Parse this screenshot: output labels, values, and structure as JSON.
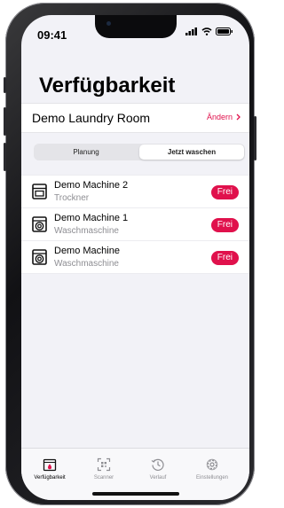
{
  "colors": {
    "accent": "#e0114c",
    "background": "#f2f2f7",
    "secondary_text": "#8e8e93"
  },
  "status_bar": {
    "time": "09:41",
    "icons": [
      "signal-icon",
      "wifi-icon",
      "battery-icon"
    ]
  },
  "page": {
    "title": "Verfügbarkeit"
  },
  "room": {
    "name": "Demo Laundry Room",
    "change_label": "Ändern",
    "change_icon": "chevron-right-icon"
  },
  "segments": [
    {
      "label": "Planung",
      "selected": false
    },
    {
      "label": "Jetzt waschen",
      "selected": true
    }
  ],
  "machines": [
    {
      "name": "Demo Machine 2",
      "type": "Trockner",
      "status": "Frei",
      "icon": "dryer-icon"
    },
    {
      "name": "Demo Machine 1",
      "type": "Waschmaschine",
      "status": "Frei",
      "icon": "washing-machine-icon"
    },
    {
      "name": "Demo Machine",
      "type": "Waschmaschine",
      "status": "Frei",
      "icon": "washing-machine-icon"
    }
  ],
  "tabs": [
    {
      "label": "Verfügbarkeit",
      "icon": "availability-icon",
      "active": true
    },
    {
      "label": "Scanner",
      "icon": "qr-scanner-icon",
      "active": false
    },
    {
      "label": "Verlauf",
      "icon": "history-icon",
      "active": false
    },
    {
      "label": "Einstellungen",
      "icon": "gear-icon",
      "active": false
    }
  ]
}
